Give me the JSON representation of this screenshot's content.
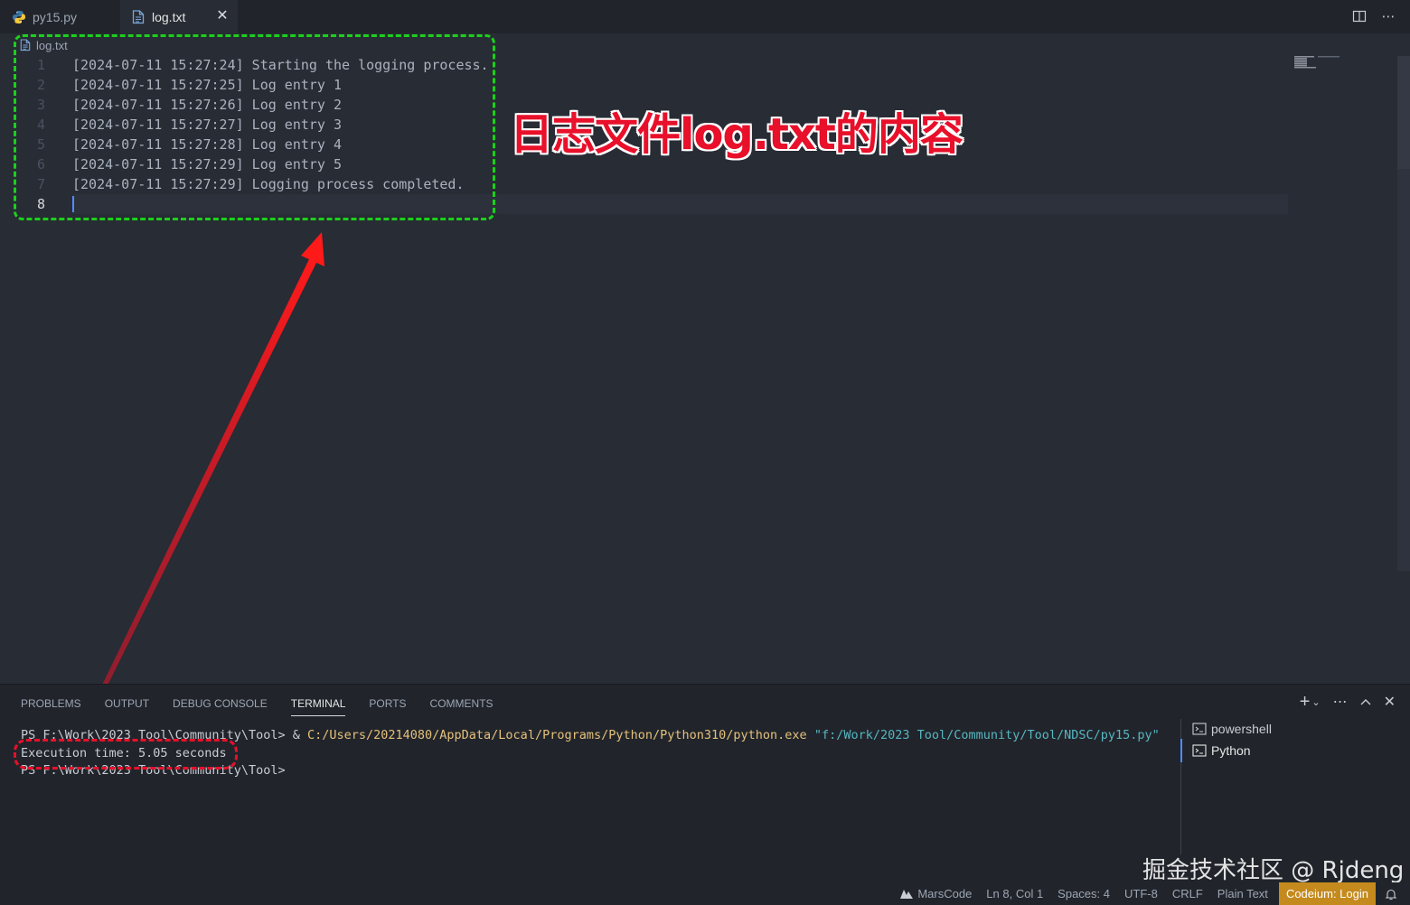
{
  "tabs": [
    {
      "label": "py15.py",
      "icon": "python-icon",
      "active": false
    },
    {
      "label": "log.txt",
      "icon": "file-text-icon",
      "active": true
    }
  ],
  "editor": {
    "breadcrumb": "log.txt",
    "lines": [
      {
        "num": "1",
        "text": "[2024-07-11 15:27:24] Starting the logging process."
      },
      {
        "num": "2",
        "text": "[2024-07-11 15:27:25] Log entry 1"
      },
      {
        "num": "3",
        "text": "[2024-07-11 15:27:26] Log entry 2"
      },
      {
        "num": "4",
        "text": "[2024-07-11 15:27:27] Log entry 3"
      },
      {
        "num": "5",
        "text": "[2024-07-11 15:27:28] Log entry 4"
      },
      {
        "num": "6",
        "text": "[2024-07-11 15:27:29] Log entry 5"
      },
      {
        "num": "7",
        "text": "[2024-07-11 15:27:29] Logging process completed."
      },
      {
        "num": "8",
        "text": ""
      }
    ]
  },
  "annotation": {
    "text": "日志文件log.txt的内容",
    "color": "#e8102a"
  },
  "panel": {
    "tabs": [
      "PROBLEMS",
      "OUTPUT",
      "DEBUG CONSOLE",
      "TERMINAL",
      "PORTS",
      "COMMENTS"
    ],
    "active_tab": "TERMINAL",
    "terminal": {
      "line1_prompt": "PS F:\\Work\\2023 Tool\\Community\\Tool> & ",
      "line1_exe": "C:/Users/20214080/AppData/Local/Programs/Python/Python310/python.exe",
      "line1_arg": "\"f:/Work/2023 Tool/Community/Tool/NDSC/py15.py\"",
      "line2": "Execution time: 5.05 seconds",
      "line3": "PS F:\\Work\\2023 Tool\\Community\\Tool> "
    },
    "terminals": [
      {
        "label": "powershell"
      },
      {
        "label": "Python"
      }
    ]
  },
  "watermark": "掘金技术社区 @ Rjdeng",
  "status": {
    "marscode": "MarsCode",
    "position": "Ln 8, Col 1",
    "spaces": "Spaces: 4",
    "encoding": "UTF-8",
    "eol": "CRLF",
    "language": "Plain Text",
    "codeium": "Codeium: Login"
  },
  "colors": {
    "editor_bg": "#282c34",
    "tabbar_bg": "#21252b",
    "green_dash": "#1bd01b",
    "red_dash": "#e8102a",
    "status_accent": "#c58a1e",
    "terminal_yellow": "#e5c07b",
    "terminal_cyan": "#56b6c2"
  }
}
